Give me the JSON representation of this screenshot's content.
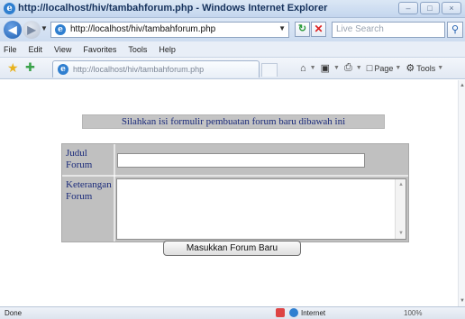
{
  "window": {
    "title": "http://localhost/hiv/tambahforum.php - Windows Internet Explorer",
    "controls": [
      "–",
      "□",
      "×"
    ]
  },
  "address_bar": {
    "url": "http://localhost/hiv/tambahforum.php",
    "search_placeholder": "Live Search"
  },
  "menu": {
    "items": [
      "File",
      "Edit",
      "View",
      "Favorites",
      "Tools",
      "Help"
    ]
  },
  "tabs": {
    "active_label": "http://localhost/hiv/tambahforum.php"
  },
  "command_bar": {
    "page": "Page",
    "tools": "Tools"
  },
  "page": {
    "instruction": "Silahkan isi formulir pembuatan forum baru dibawah ini",
    "form": {
      "title_label": "Judul Forum",
      "title_value": "",
      "description_label": "Keterangan Forum",
      "description_value": "",
      "submit_label": "Masukkan Forum Baru"
    }
  },
  "status_bar": {
    "status": "Done",
    "zone": "Internet",
    "zoom": "100%"
  },
  "icons": {
    "ie_logo": "ie-logo-icon",
    "back": "back-arrow-icon",
    "forward": "forward-arrow-icon",
    "refresh": "refresh-icon",
    "stop": "stop-icon",
    "search": "search-icon",
    "favorites_star": "star-icon",
    "add_favorites": "add-favorites-icon",
    "home": "home-icon",
    "feeds": "feeds-icon",
    "print": "print-icon",
    "page": "page-icon",
    "tools": "gear-icon",
    "globe": "globe-icon"
  },
  "colors": {
    "form_background": "#c0c0c0",
    "label_text": "#1a2a7a",
    "chrome_blue": "#c4d6ee"
  }
}
